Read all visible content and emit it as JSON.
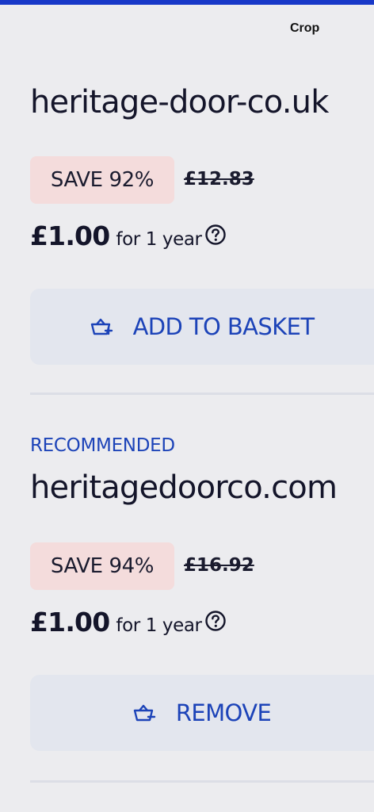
{
  "header": {
    "crop_label": "Crop"
  },
  "results": [
    {
      "recommended_label": "",
      "domain": "heritage-door-co.uk",
      "save_badge": "SAVE 92%",
      "old_price": "£12.83",
      "price": "£1.00",
      "term": "for 1 year",
      "action_label": "ADD TO BASKET",
      "action_icon": "basket-add-icon"
    },
    {
      "recommended_label": "RECOMMENDED",
      "domain": "heritagedoorco.com",
      "save_badge": "SAVE 94%",
      "old_price": "£16.92",
      "price": "£1.00",
      "term": "for 1 year",
      "action_label": "REMOVE",
      "action_icon": "basket-remove-icon"
    }
  ],
  "colors": {
    "accent": "#1c43b8",
    "badge_bg": "#f4dcdc",
    "button_bg": "#e3e6ee",
    "top_bar": "#1838c8"
  }
}
